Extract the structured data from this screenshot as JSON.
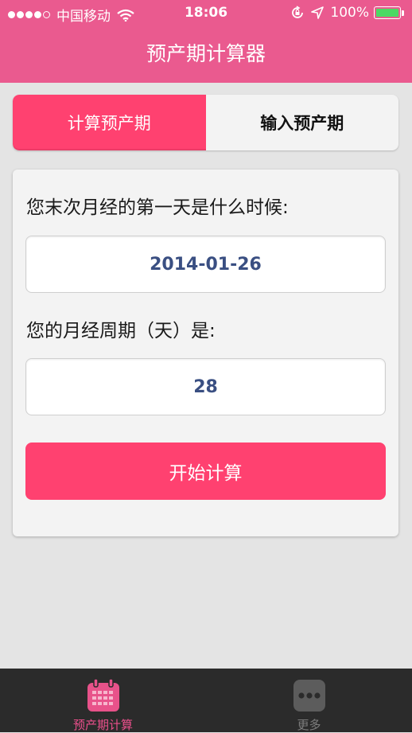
{
  "status_bar": {
    "carrier": "中国移动",
    "time": "18:06",
    "battery_percent": "100%",
    "battery_color": "#4cd964",
    "icons": [
      "signal-dots-icon",
      "wifi-icon",
      "rotation-lock-icon",
      "location-arrow-icon",
      "battery-icon"
    ]
  },
  "nav": {
    "title": "预产期计算器",
    "background_color": "#ea5a8f"
  },
  "segmented": {
    "tabs": [
      {
        "label": "计算预产期",
        "selected": true
      },
      {
        "label": "输入预产期",
        "selected": false
      }
    ],
    "accent_color": "#ff4170"
  },
  "form": {
    "last_period_label": "您末次月经的第一天是什么时候:",
    "last_period_value": "2014-01-26",
    "cycle_label": "您的月经周期（天）是:",
    "cycle_value": "28",
    "submit_label": "开始计算",
    "value_color": "#3a4f82"
  },
  "tab_bar": {
    "items": [
      {
        "label": "预产期计算",
        "icon": "calendar-icon",
        "active": true
      },
      {
        "label": "更多",
        "icon": "more-icon",
        "active": false
      }
    ]
  }
}
